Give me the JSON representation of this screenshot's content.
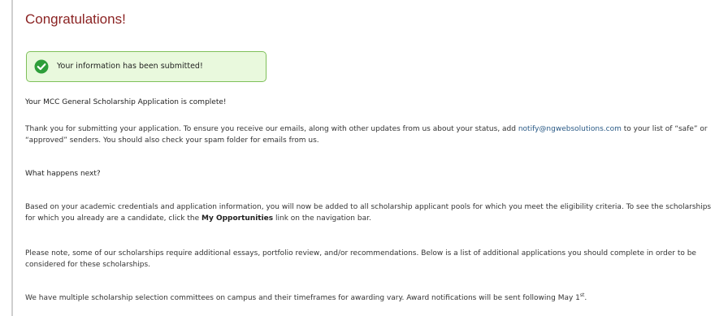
{
  "page": {
    "title": "Congratulations!",
    "alert": {
      "icon": "check-circle-icon",
      "text": "Your information has been submitted!"
    },
    "complete_heading": "Your MCC General Scholarship Application is complete!",
    "thanks": {
      "line1_before": "Thank you for submitting your application. To ensure you receive our emails, along with other updates from us about your status, add ",
      "email": "notify@ngwebsolutions.com",
      "line1_after": " to your list of “safe” or",
      "line2": "“approved” senders. You should also check your spam folder for emails from us."
    },
    "next_heading": "What happens next?",
    "next_para": {
      "line1": "Based on your academic credentials and application information, you will now be added to all scholarship applicant pools for which you meet the eligibility criteria.  To see the scholarships",
      "line2_before": "for which you already are a candidate, click the ",
      "line2_link": "My Opportunities",
      "line2_after": " link on the navigation bar."
    },
    "note_para": {
      "line1": "Please note, some of our scholarships require additional essays, portfolio review, and/or recommendations.  Below is a list of additional applications you should complete in order to be",
      "line2": "considered for these scholarships."
    },
    "committees_para": {
      "text": "We have multiple scholarship selection committees on campus and their timeframes for awarding vary.  Award notifications will be sent following May 1",
      "sup": "st",
      "end": "."
    },
    "colors": {
      "title": "#8b2323",
      "alert_bg": "#e9f9dd",
      "alert_border": "#7fc05a",
      "check": "#2e9e3a",
      "link": "#2a5a86"
    }
  }
}
